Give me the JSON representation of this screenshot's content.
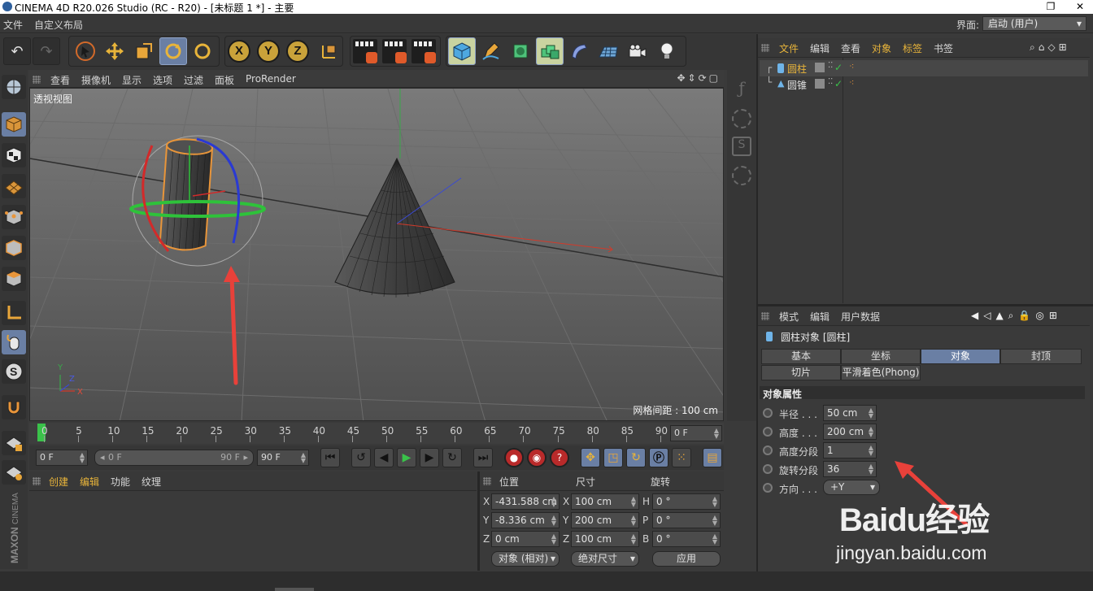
{
  "window": {
    "title": "CINEMA 4D R20.026 Studio (RC - R20) - [未标题 1 *] - 主要",
    "restore_glyph": "❐",
    "close_glyph": "✕"
  },
  "menubar": {
    "items": [
      "文件",
      "自定义布局"
    ],
    "layout_label": "界面:",
    "layout_value": "启动 (用户)"
  },
  "viewport": {
    "menu": [
      "查看",
      "摄像机",
      "显示",
      "选项",
      "过滤",
      "面板",
      "ProRender"
    ],
    "label": "透视视图",
    "grid_spacing": "网格间距 : 100 cm",
    "axis_labels": {
      "y": "Y",
      "z": "Z",
      "x": "X"
    }
  },
  "timeline": {
    "ticks": [
      "0",
      "5",
      "10",
      "15",
      "20",
      "25",
      "30",
      "35",
      "40",
      "45",
      "50",
      "55",
      "60",
      "65",
      "70",
      "75",
      "80",
      "85",
      "90"
    ],
    "current_frame": "0 F",
    "start_frame": "0 F",
    "range_start": "0 F",
    "range_end": "90 F",
    "end_frame": "90 F"
  },
  "material_manager": {
    "menu": [
      "创建",
      "编辑",
      "功能",
      "纹理"
    ]
  },
  "coordinates": {
    "headers": [
      "位置",
      "尺寸",
      "旋转"
    ],
    "rows": [
      {
        "pos_axis": "X",
        "pos": "-431.588 cm",
        "size_axis": "X",
        "size": "100 cm",
        "rot_axis": "H",
        "rot": "0 °"
      },
      {
        "pos_axis": "Y",
        "pos": "-8.336 cm",
        "size_axis": "Y",
        "size": "200 cm",
        "rot_axis": "P",
        "rot": "0 °"
      },
      {
        "pos_axis": "Z",
        "pos": "0 cm",
        "size_axis": "Z",
        "size": "100 cm",
        "rot_axis": "B",
        "rot": "0 °"
      }
    ],
    "mode": "对象 (相对)",
    "size_mode": "绝对尺寸",
    "apply": "应用"
  },
  "object_manager": {
    "menu": [
      "文件",
      "编辑",
      "查看",
      "对象",
      "标签",
      "书签"
    ],
    "objects": [
      {
        "name": "圆柱",
        "selected": true
      },
      {
        "name": "圆锥",
        "selected": false
      }
    ]
  },
  "attribute_manager": {
    "menu": [
      "模式",
      "编辑",
      "用户数据"
    ],
    "object_title": "圆柱对象 [圆柱]",
    "tabs_row1": [
      "基本",
      "坐标",
      "对象",
      "封顶"
    ],
    "tabs_row2": [
      "切片",
      "平滑着色(Phong)"
    ],
    "active_tab": "对象",
    "section_title": "对象属性",
    "properties": [
      {
        "label": "半径 . . .",
        "value": "50 cm"
      },
      {
        "label": "高度 . . .",
        "value": "200 cm"
      },
      {
        "label": "高度分段",
        "value": "1"
      },
      {
        "label": "旋转分段",
        "value": "36"
      },
      {
        "label": "方向 . . .",
        "value": "+Y"
      }
    ]
  },
  "side_logo": {
    "brand": "MAXON",
    "product": "CINEMA 4D"
  },
  "watermark": {
    "brand": "Baidu经验",
    "url": "jingyan.baidu.com"
  },
  "colors": {
    "selection_blue": "#6a7fa4",
    "annotation_red": "#e8413a",
    "object_orange": "#d9953a"
  }
}
